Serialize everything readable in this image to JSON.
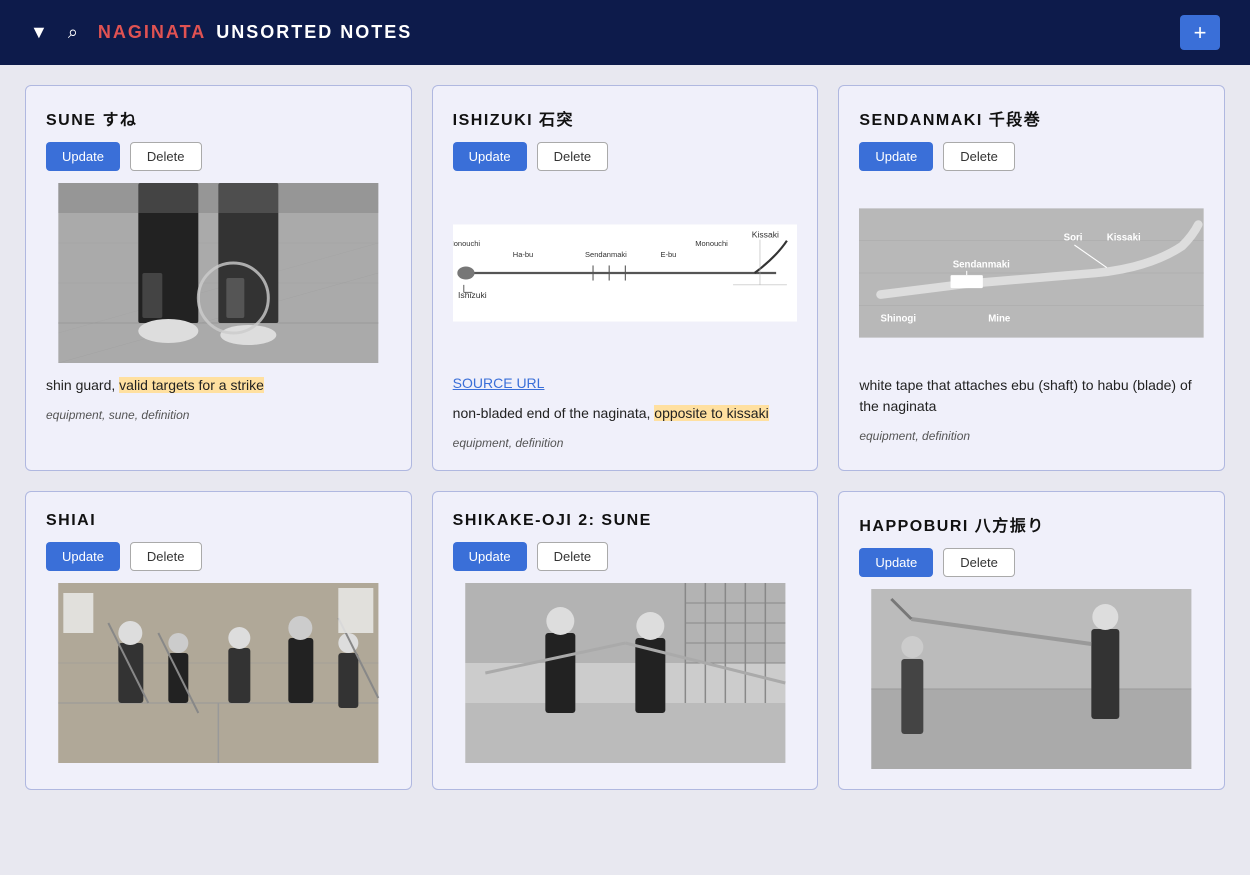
{
  "header": {
    "brand": "NAGINATA",
    "subtitle": "UNSORTED NOTES",
    "add_label": "+",
    "filter_icon": "▼",
    "search_icon": "🔍"
  },
  "cards": [
    {
      "id": "sune",
      "title": "SUNE すね",
      "update_label": "Update",
      "delete_label": "Delete",
      "has_image": true,
      "image_type": "sune_photo",
      "source_url": null,
      "description": "shin guard, valid targets for a strike",
      "description_highlight": "valid targets for a strike",
      "tags": "equipment, sune, definition"
    },
    {
      "id": "ishizuki",
      "title": "ISHIZUKI 石突",
      "update_label": "Update",
      "delete_label": "Delete",
      "has_image": true,
      "image_type": "ishizuki_diagram",
      "source_url": "SOURCE URL",
      "description": "non-bladed end of the naginata, opposite to kissaki",
      "description_highlight": "opposite to kissaki",
      "tags": "equipment, definition"
    },
    {
      "id": "sendanmaki",
      "title": "SENDANMAKI 千段巻",
      "update_label": "Update",
      "delete_label": "Delete",
      "has_image": true,
      "image_type": "sendanmaki_photo",
      "source_url": null,
      "description": "white tape that attaches ebu (shaft) to habu (blade) of the naginata",
      "tags": "equipment, definition"
    },
    {
      "id": "shiai",
      "title": "SHIAI",
      "update_label": "Update",
      "delete_label": "Delete",
      "has_image": true,
      "image_type": "shiai_photo",
      "source_url": null,
      "description": "",
      "tags": ""
    },
    {
      "id": "shikake-oji-2",
      "title": "SHIKAKE-OJI 2: SUNE",
      "update_label": "Update",
      "delete_label": "Delete",
      "has_image": true,
      "image_type": "shikake_photo",
      "source_url": null,
      "description": "",
      "tags": ""
    },
    {
      "id": "happoburi",
      "title": "HAPPOBURI 八方振り",
      "update_label": "Update",
      "delete_label": "Delete",
      "has_image": true,
      "image_type": "happoburi_photo",
      "source_url": null,
      "description": "",
      "tags": ""
    }
  ],
  "diagram_labels": {
    "kissaki": "Kissaki",
    "monouchi": "Monouchi",
    "habu": "Ha-bu",
    "sendanmaki_label": "Sendanmaki",
    "ebu": "E-bu",
    "monouchi2": "Monouchi",
    "ishizuki_label": "Ishizuki"
  },
  "sendanmaki_photo_labels": {
    "sendanmaki": "Sendanmaki",
    "sori": "Sori",
    "shinogi": "Shinogi",
    "mine": "Mine",
    "kissaki": "Kissaki"
  }
}
